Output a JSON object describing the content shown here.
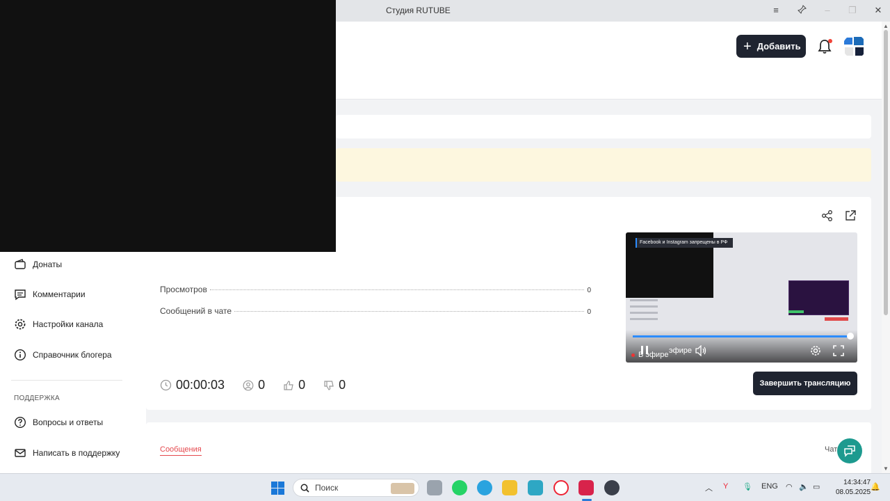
{
  "window": {
    "title": "Студия RUTUBE",
    "controls": [
      "menu-icon",
      "pin-icon",
      "minimize-icon",
      "restore-icon",
      "close-icon"
    ]
  },
  "header": {
    "add_button_label": "Добавить"
  },
  "stream": {
    "stats": [
      {
        "label": "Просмотров",
        "value": "0"
      },
      {
        "label": "Сообщений в чате",
        "value": "0"
      }
    ],
    "timer": "00:00:03",
    "viewers": "0",
    "likes": "0",
    "dislikes": "0",
    "finish_button_label": "Завершить трансляцию",
    "player": {
      "banner_text": "Facebook и Instagram запрещены в РФ",
      "live_label": "В эфире",
      "live_label_partial": "эфире",
      "progress": 1.0
    }
  },
  "tabs": {
    "messages": "Сообщения",
    "chat": "Чат"
  },
  "sidebar": {
    "items": [
      {
        "label": "Донаты",
        "icon": "wallet-icon"
      },
      {
        "label": "Комментарии",
        "icon": "comment-icon"
      },
      {
        "label": "Настройки канала",
        "icon": "gear-icon"
      },
      {
        "label": "Справочник блогера",
        "icon": "info-icon"
      }
    ],
    "support_label": "ПОДДЕРЖКА",
    "support_items": [
      {
        "label": "Вопросы и ответы",
        "icon": "question-icon"
      },
      {
        "label": "Написать в поддержку",
        "icon": "mail-icon"
      }
    ]
  },
  "taskbar": {
    "search_placeholder": "Поиск",
    "language": "ENG",
    "time": "14:34:47",
    "date": "08.05.2025"
  },
  "colors": {
    "accent_dark": "#1f2430",
    "accent_red": "#e5484d",
    "fab_teal": "#1d9a8f",
    "notice_yellow": "#fdf7df"
  }
}
